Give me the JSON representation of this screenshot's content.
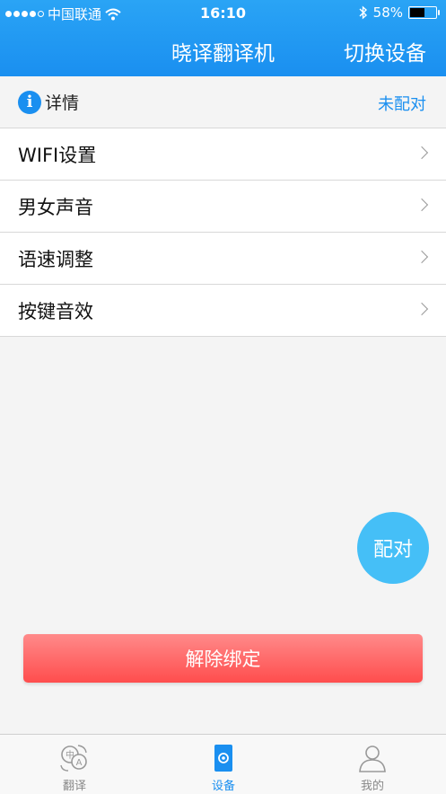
{
  "status_bar": {
    "carrier": "中国联通",
    "time": "16:10",
    "battery_percent": "58%",
    "battery_level": 0.58,
    "signal_bars": 4
  },
  "header": {
    "title": "晓译翻译机",
    "switch_device": "切换设备"
  },
  "detail": {
    "icon_letter": "i",
    "title": "详情",
    "pair_status": "未配对"
  },
  "settings": [
    {
      "label": "WIFI设置"
    },
    {
      "label": "男女声音"
    },
    {
      "label": "语速调整"
    },
    {
      "label": "按键音效"
    }
  ],
  "pair_button": "配对",
  "unbind_button": "解除绑定",
  "tabs": [
    {
      "label": "翻译",
      "icon": "translate-icon"
    },
    {
      "label": "设备",
      "icon": "device-icon"
    },
    {
      "label": "我的",
      "icon": "profile-icon"
    }
  ],
  "colors": {
    "accent": "#1a8ff0",
    "header": "#2aa4f5",
    "fab": "#45bff7",
    "unbind": "#ff4d4d"
  }
}
